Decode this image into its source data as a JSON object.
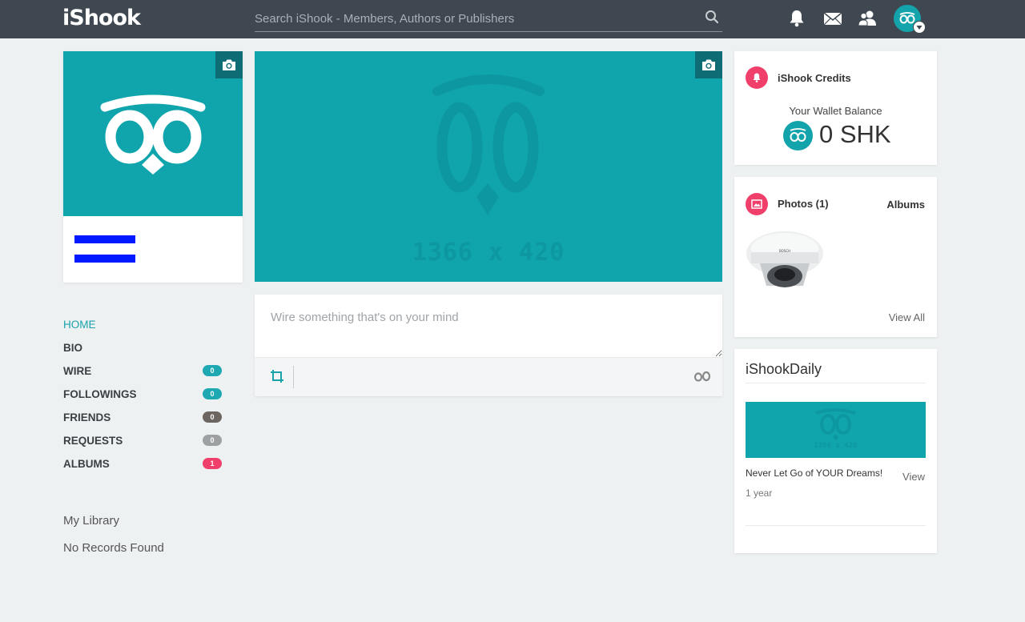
{
  "header": {
    "logo": "iShook",
    "search_placeholder": "Search iShook - Members, Authors or Publishers",
    "icons": [
      "search-icon",
      "bell-icon",
      "mail-icon",
      "users-icon",
      "avatar"
    ]
  },
  "cover": {
    "placeholder_text": "1366 x 420"
  },
  "composer": {
    "placeholder": "Wire something that's on your mind"
  },
  "nav": {
    "items": [
      {
        "label": "HOME",
        "badge": null,
        "badge_color": null
      },
      {
        "label": "BIO",
        "badge": null,
        "badge_color": null
      },
      {
        "label": "WIRE",
        "badge": "0",
        "badge_color": "#1ea8b2"
      },
      {
        "label": "FOLLOWINGS",
        "badge": "0",
        "badge_color": "#1ea8b2"
      },
      {
        "label": "FRIENDS",
        "badge": "0",
        "badge_color": "#6d655f"
      },
      {
        "label": "REQUESTS",
        "badge": "0",
        "badge_color": "#9ea1a3"
      },
      {
        "label": "ALBUMS",
        "badge": "1",
        "badge_color": "#f03f6a"
      }
    ]
  },
  "library": {
    "title": "My Library",
    "empty_text": "No Records Found"
  },
  "credits": {
    "title": "iShook Credits",
    "wallet_label": "Your Wallet Balance",
    "amount": "0 SHK"
  },
  "photos": {
    "title": "Photos (1)",
    "albums_link": "Albums",
    "view_all": "View All"
  },
  "daily": {
    "title": "iShookDaily",
    "image_text": "1366 x 420",
    "headline": "Never Let Go of YOUR Dreams!",
    "view": "View",
    "time": "1 year"
  },
  "colors": {
    "topbar": "#3f4850",
    "brand_teal": "#10a4ad",
    "accent_pink": "#f03f6a",
    "background": "#eef1f2"
  }
}
